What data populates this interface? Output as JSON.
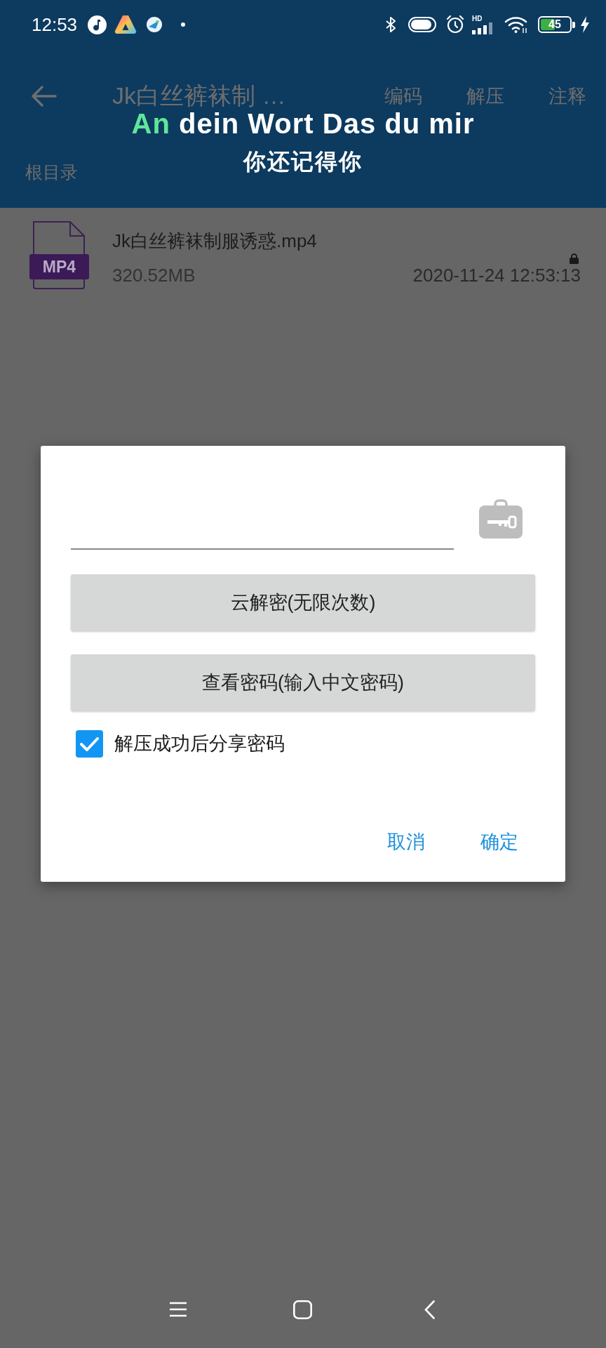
{
  "status_bar": {
    "time": "12:53",
    "network_type": "HD",
    "battery": "45"
  },
  "app_bar": {
    "title": "Jk白丝裤袜制 …",
    "actions": [
      "编码",
      "解压",
      "注释"
    ],
    "path": "根目录"
  },
  "lyrics_overlay": {
    "lines": [
      {
        "segments": [
          {
            "text": "An",
            "sung": true
          },
          {
            "text": " dein Wort Das du mir",
            "sung": false
          }
        ]
      },
      {
        "segments": [
          {
            "text": "你还记得你",
            "sung": false
          }
        ]
      }
    ]
  },
  "files": [
    {
      "type_label": "MP4",
      "name": "Jk白丝裤袜制服诱惑.mp4",
      "size": "320.52MB",
      "modified": "2020-11-24 12:53:13",
      "locked": true
    }
  ],
  "dialog": {
    "buttons": [
      "云解密(无限次数)",
      "查看密码(输入中文密码)"
    ],
    "share_option": {
      "label": "解压成功后分享密码",
      "checked": true
    },
    "actions": [
      "取消",
      "确定"
    ]
  }
}
